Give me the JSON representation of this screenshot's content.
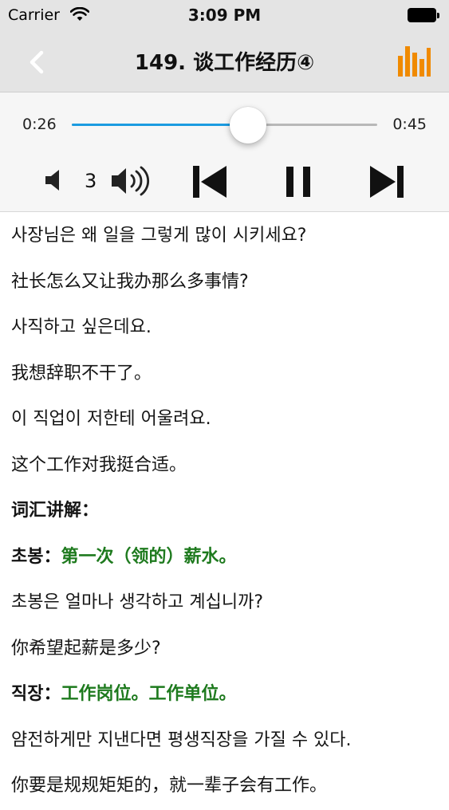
{
  "status_bar": {
    "carrier": "Carrier",
    "time": "3:09 PM"
  },
  "nav": {
    "title": "149. 谈工作经历④",
    "accent_color": "#f08a00"
  },
  "player": {
    "current_time": "0:26",
    "total_time": "0:45",
    "progress": 0.578,
    "volume_level": "3",
    "accent_color": "#1b9be0"
  },
  "content": {
    "lines": [
      "사장님은 왜 일을 그렇게 많이 시키세요?",
      "社长怎么又让我办那么多事情?",
      "사직하고 싶은데요.",
      "我想辞职不干了。",
      "이 직업이 저한테 어울려요.",
      "这个工作对我挺合适。",
      "词汇讲解：",
      "초봉은 얼마나 생각하고 계십니까?",
      "你希望起薪是多少?",
      "얌전하게만 지낸다면 평생직장을 가질 수 있다.",
      "你要是规规矩矩的，就一辈子会有工作。"
    ],
    "vocab": [
      {
        "term": "초봉：",
        "definition": "第一次（领的）薪水。"
      },
      {
        "term": "직장：",
        "definition": "工作岗位。工作单位。"
      }
    ],
    "definition_color": "#1e7a1e"
  }
}
